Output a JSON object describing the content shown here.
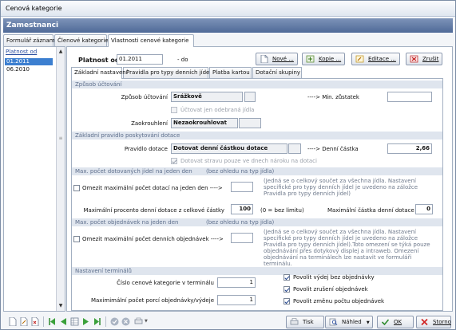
{
  "window": {
    "title": "Cenová kategorie"
  },
  "header": {
    "title": "Zamestnanci"
  },
  "tabs": [
    {
      "label": "Formulář záznamu"
    },
    {
      "label": "Členové kategorie"
    },
    {
      "label": "Vlastnosti cenové kategorie"
    }
  ],
  "list": {
    "header": "Platnost od",
    "items": [
      {
        "label": "01.2011",
        "selected": true
      },
      {
        "label": "06.2010",
        "selected": false
      }
    ]
  },
  "platnost": {
    "label": "Platnost od",
    "value": "01.2011",
    "to_label": "- do"
  },
  "actions": {
    "new": "Nové ...",
    "copy": "Kopie ...",
    "edit": "Editace ...",
    "cancel": "Zrušit"
  },
  "subtabs": [
    {
      "label": "Základní nastavení"
    },
    {
      "label": "Pravidla pro typy denních jídel"
    },
    {
      "label": "Platba kartou"
    },
    {
      "label": "Dotační skupiny"
    }
  ],
  "s1": {
    "title": "Způsob účtování",
    "method_label": "Způsob účtování",
    "method_value": "Srážkově",
    "arrow_label": "----> Min. zůstatek",
    "only_taken_label": "Účtovat jen odebraná jídla",
    "rounding_label": "Zaokrouhlení",
    "rounding_value": "Nezaokrouhlovat"
  },
  "s2": {
    "title": "Základní pravidlo poskytování dotace",
    "rule_label": "Pravidlo dotace",
    "rule_value": "Dotovat denní částkou dotace",
    "arrow_label": "----> Denní částka",
    "daily_amount": "2,66",
    "only_claim_label": "Dotovat stravu pouze ve dnech nároku na dotaci"
  },
  "s3": {
    "title": "Max. počet dotovaných jídel na jeden den",
    "subtitle": "(bez ohledu na typ jídla)",
    "limit_label": "Omezit maximální počet dotací na jeden den ---->",
    "note": "(Jedná se o celkový součet za všechna jídla. Nastavení specifické pro typy denních jídel je uvedeno na záložce Pravidla pro typy denních jídel)",
    "max_pct_label": "Maximální procento denní dotace z celkové částky",
    "max_pct_value": "100",
    "max_pct_note": "(0 = bez limitu)",
    "max_amount_label": "Maximální částka denní dotace",
    "max_amount_value": "0"
  },
  "s4": {
    "title": "Max. počet objednávek na jeden den",
    "subtitle": "(bez ohledu na typ jídla)",
    "limit_label": "Omezit maximální počet denních objednávek ---->",
    "note": "(Jedná se o celkový součet za všechna jídla. Nastavení specifické pro typy denních jídel je uvedeno na záložce Pravidla pro typy denních jídel).Toto omezení se týká pouze objednávání přes dotykový displej a intraweb. Omezení objednávání na terminálech lze nastavit ve formuláři terminálu."
  },
  "s5": {
    "title": "Nastavení terminálů",
    "cat_label": "Číslo cenové kategorie v terminálu",
    "cat_value": "1",
    "max_label": "Maximimální počet porcí objednávky/výdeje",
    "max_value": "1",
    "cb1": "Povolit výdej bez objednávky",
    "cb2": "Povolit zrušení objednávek",
    "cb3": "Povolit změnu počtu objednávek"
  },
  "footer": {
    "print": "Tisk",
    "preview": "Náhled",
    "ok": "OK",
    "cancel": "Storno"
  }
}
